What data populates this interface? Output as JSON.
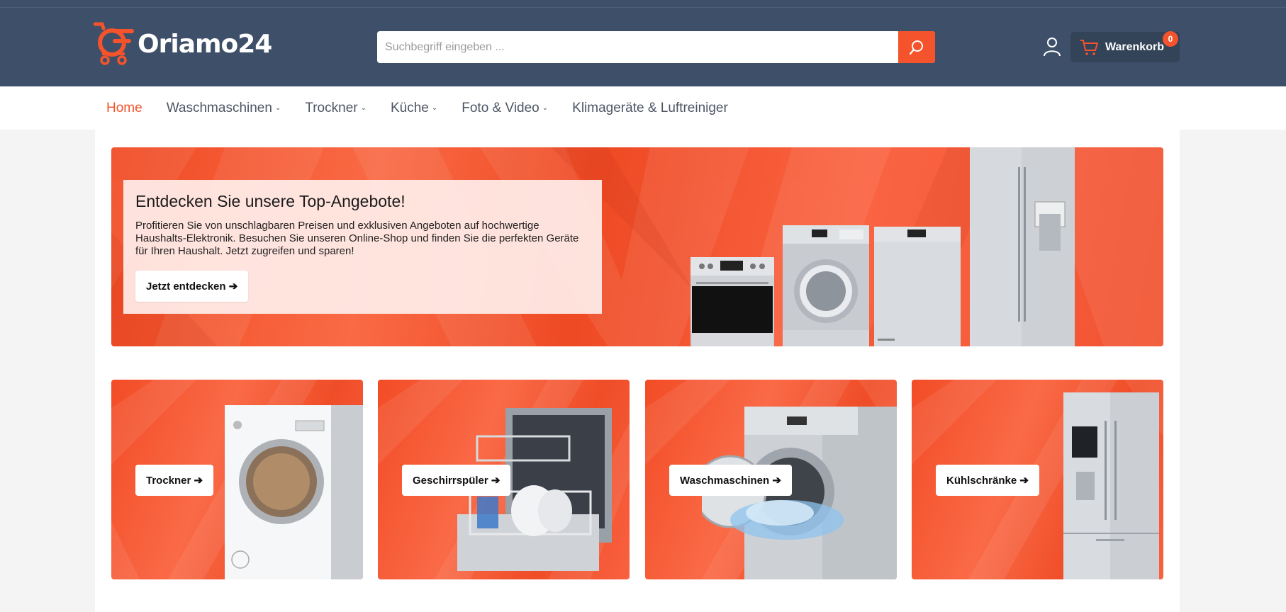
{
  "brand": {
    "name": "Oriamo24",
    "accent": "#f5532b",
    "header_bg": "#3e5069"
  },
  "search": {
    "placeholder": "Suchbegriff eingeben ...",
    "icon": "search-icon"
  },
  "account": {
    "icon": "user-icon"
  },
  "cart": {
    "label": "Warenkorb",
    "count": "0",
    "icon": "cart-icon"
  },
  "nav": {
    "items": [
      {
        "label": "Home",
        "active": true,
        "has_dropdown": false
      },
      {
        "label": "Waschmaschinen",
        "active": false,
        "has_dropdown": true
      },
      {
        "label": "Trockner",
        "active": false,
        "has_dropdown": true
      },
      {
        "label": "Küche",
        "active": false,
        "has_dropdown": true
      },
      {
        "label": "Foto & Video",
        "active": false,
        "has_dropdown": true
      },
      {
        "label": "Klimageräte & Luftreiniger",
        "active": false,
        "has_dropdown": false
      }
    ]
  },
  "hero": {
    "title": "Entdecken Sie unsere Top-Angebote!",
    "text": "Profitieren Sie von unschlagbaren Preisen und exklusiven Angeboten auf hochwertige Haushalts-Elektronik. Besuchen Sie unseren Online-Shop und finden Sie die perfekten Geräte für Ihren Haushalt. Jetzt zugreifen und sparen!",
    "button": "Jetzt entdecken ➔"
  },
  "categories": [
    {
      "label": "Trockner ➔",
      "image": "dryer"
    },
    {
      "label": "Geschirrspüler ➔",
      "image": "dishwasher"
    },
    {
      "label": "Waschmaschinen ➔",
      "image": "washing-machine"
    },
    {
      "label": "Kühlschränke ➔",
      "image": "fridge"
    }
  ]
}
